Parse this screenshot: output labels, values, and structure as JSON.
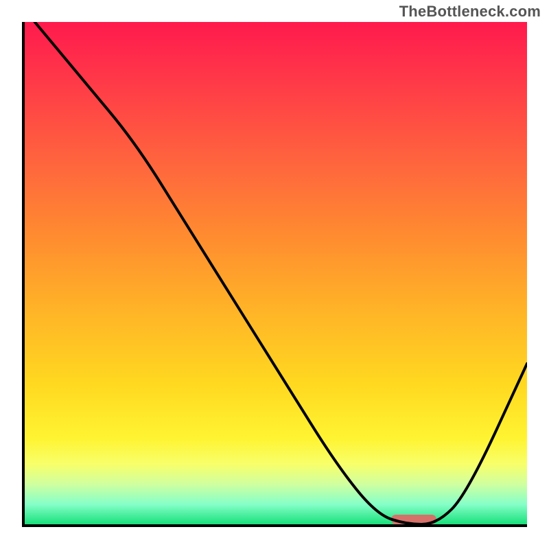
{
  "watermark": "TheBottleneck.com",
  "chart_data": {
    "type": "line",
    "title": "",
    "xlabel": "",
    "ylabel": "",
    "xlim": [
      0,
      100
    ],
    "ylim": [
      0,
      100
    ],
    "grid": false,
    "legend": false,
    "annotations": [],
    "background_gradient": "red-to-green (top-to-bottom)",
    "series": [
      {
        "name": "bottleneck-curve",
        "color": "#000000",
        "x": [
          2,
          12,
          22,
          32,
          42,
          52,
          62,
          70,
          76,
          82,
          88,
          100
        ],
        "y": [
          100,
          88,
          76,
          60,
          44,
          28,
          12,
          2,
          0,
          0,
          6,
          32
        ]
      }
    ],
    "marker": {
      "name": "optimal-range",
      "x_start": 73,
      "x_end": 82,
      "y": 0,
      "color": "#d6716a"
    }
  },
  "colors": {
    "axis": "#000000",
    "curve": "#000000",
    "marker": "#d6716a",
    "watermark": "#555555"
  }
}
